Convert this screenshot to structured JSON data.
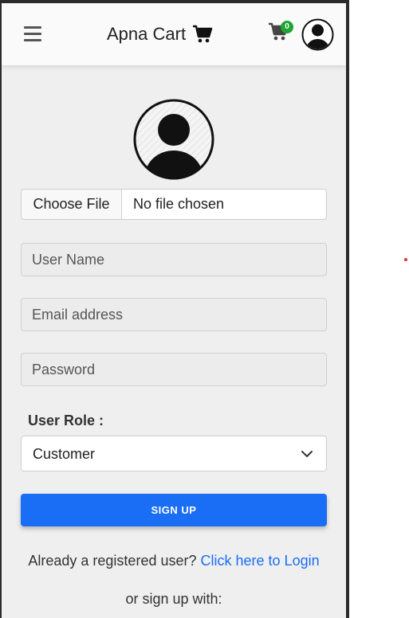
{
  "header": {
    "brand_title": "Apna Cart",
    "cart_count": "0",
    "icons": {
      "menu": "hamburger-icon",
      "brand": "shopping-cart-icon",
      "cart": "shopping-cart-icon",
      "profile": "user-avatar-icon"
    }
  },
  "form": {
    "file_button_label": "Choose File",
    "file_status": "No file chosen",
    "username_placeholder": "User Name",
    "email_placeholder": "Email address",
    "password_placeholder": "Password",
    "role_label": "User Role :",
    "role_selected": "Customer",
    "signup_label": "SIGN UP"
  },
  "footer": {
    "login_prompt": "Already a registered user?",
    "login_link": "Click here to Login",
    "alt_signup": "or sign up with:"
  },
  "colors": {
    "accent": "#1a6ef5",
    "badge": "#1fa533",
    "background": "#efefef"
  }
}
